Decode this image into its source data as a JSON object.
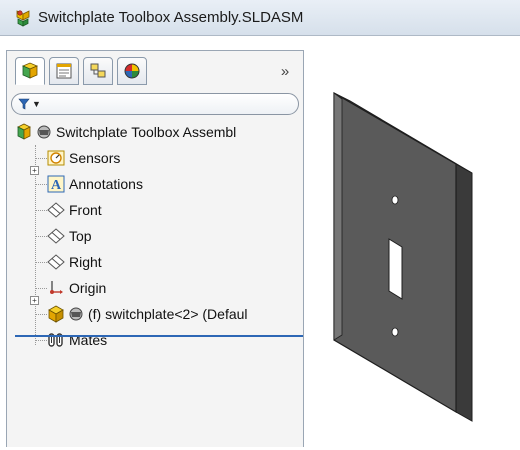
{
  "window": {
    "title": "Switchplate Toolbox Assembly.SLDASM",
    "icon": "assembly-icon"
  },
  "panel": {
    "tabs": [
      {
        "icon": "featuremanager-icon",
        "active": true
      },
      {
        "icon": "propertymanager-icon",
        "active": false
      },
      {
        "icon": "configurationmanager-icon",
        "active": false
      },
      {
        "icon": "displaymanager-icon",
        "active": false
      }
    ],
    "more_label": "»",
    "filter_icon": "filter-icon"
  },
  "tree": {
    "root": "Switchplate Toolbox Assembl",
    "items": [
      {
        "label": "Sensors",
        "icon": "sensors-icon"
      },
      {
        "label": "Annotations",
        "icon": "annotations-icon"
      },
      {
        "label": "Front",
        "icon": "plane-icon"
      },
      {
        "label": "Top",
        "icon": "plane-icon"
      },
      {
        "label": "Right",
        "icon": "plane-icon"
      },
      {
        "label": "Origin",
        "icon": "origin-icon"
      },
      {
        "label": "(f) switchplate<2> (Defaul",
        "icon": "part-icon"
      },
      {
        "label": "Mates",
        "icon": "mates-icon"
      }
    ]
  },
  "model": {
    "name": "switchplate",
    "colors": {
      "face": "#585858",
      "side": "#3a3a3a",
      "edge": "#1e1e1e",
      "hole": "#ffffff"
    }
  }
}
